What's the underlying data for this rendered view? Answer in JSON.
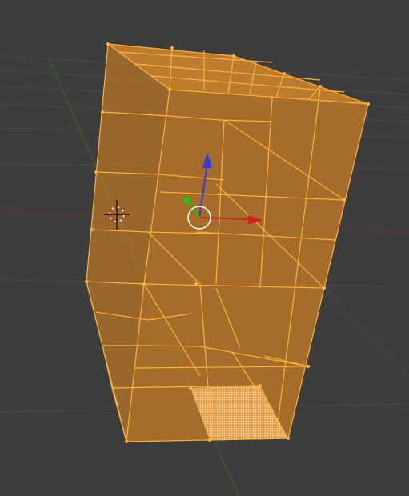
{
  "viewport": {
    "background": "#3d3d3d",
    "grid_color": "#4a4a4a",
    "x_axis_color": "#7a2c2c",
    "y_axis_color": "#3a6b2c"
  },
  "mesh": {
    "mode": "edit-mode-selected",
    "fill_color": "#e38a1f",
    "edge_color": "#ffb040",
    "selected_face_pattern": "dotted-white"
  },
  "gizmo": {
    "x_handle_color": "#d42020",
    "y_handle_color": "#20c020",
    "z_handle_color": "#3a3ad8",
    "pivot_color": "#ffffff"
  },
  "cursor_3d": {
    "icon": "3d-cursor-icon"
  }
}
